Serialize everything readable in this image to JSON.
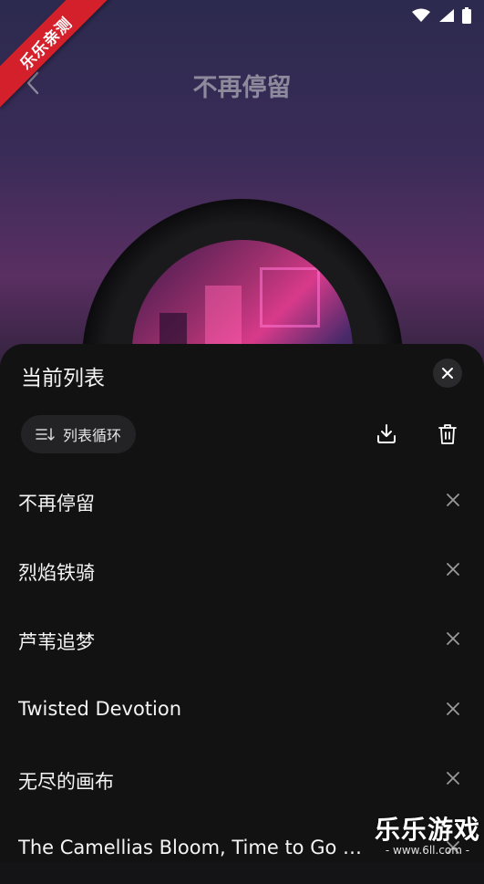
{
  "watermark": {
    "ribbon": "乐乐亲测",
    "brand": "乐乐游戏",
    "url": "- www.6ll.com -"
  },
  "header": {
    "title": "不再停留"
  },
  "sheet": {
    "title": "当前列表",
    "mode_label": "列表循环",
    "items": [
      {
        "label": "不再停留"
      },
      {
        "label": "烈焰铁骑"
      },
      {
        "label": "芦苇追梦"
      },
      {
        "label": "Twisted Devotion"
      },
      {
        "label": "无尽的画布"
      },
      {
        "label": "The Camellias Bloom, Time to Go Ho..."
      }
    ]
  },
  "icons": {
    "back": "chevron-left-icon",
    "close": "close-icon",
    "mode": "list-loop-icon",
    "download": "download-icon",
    "delete": "trash-icon",
    "remove": "x-icon"
  }
}
